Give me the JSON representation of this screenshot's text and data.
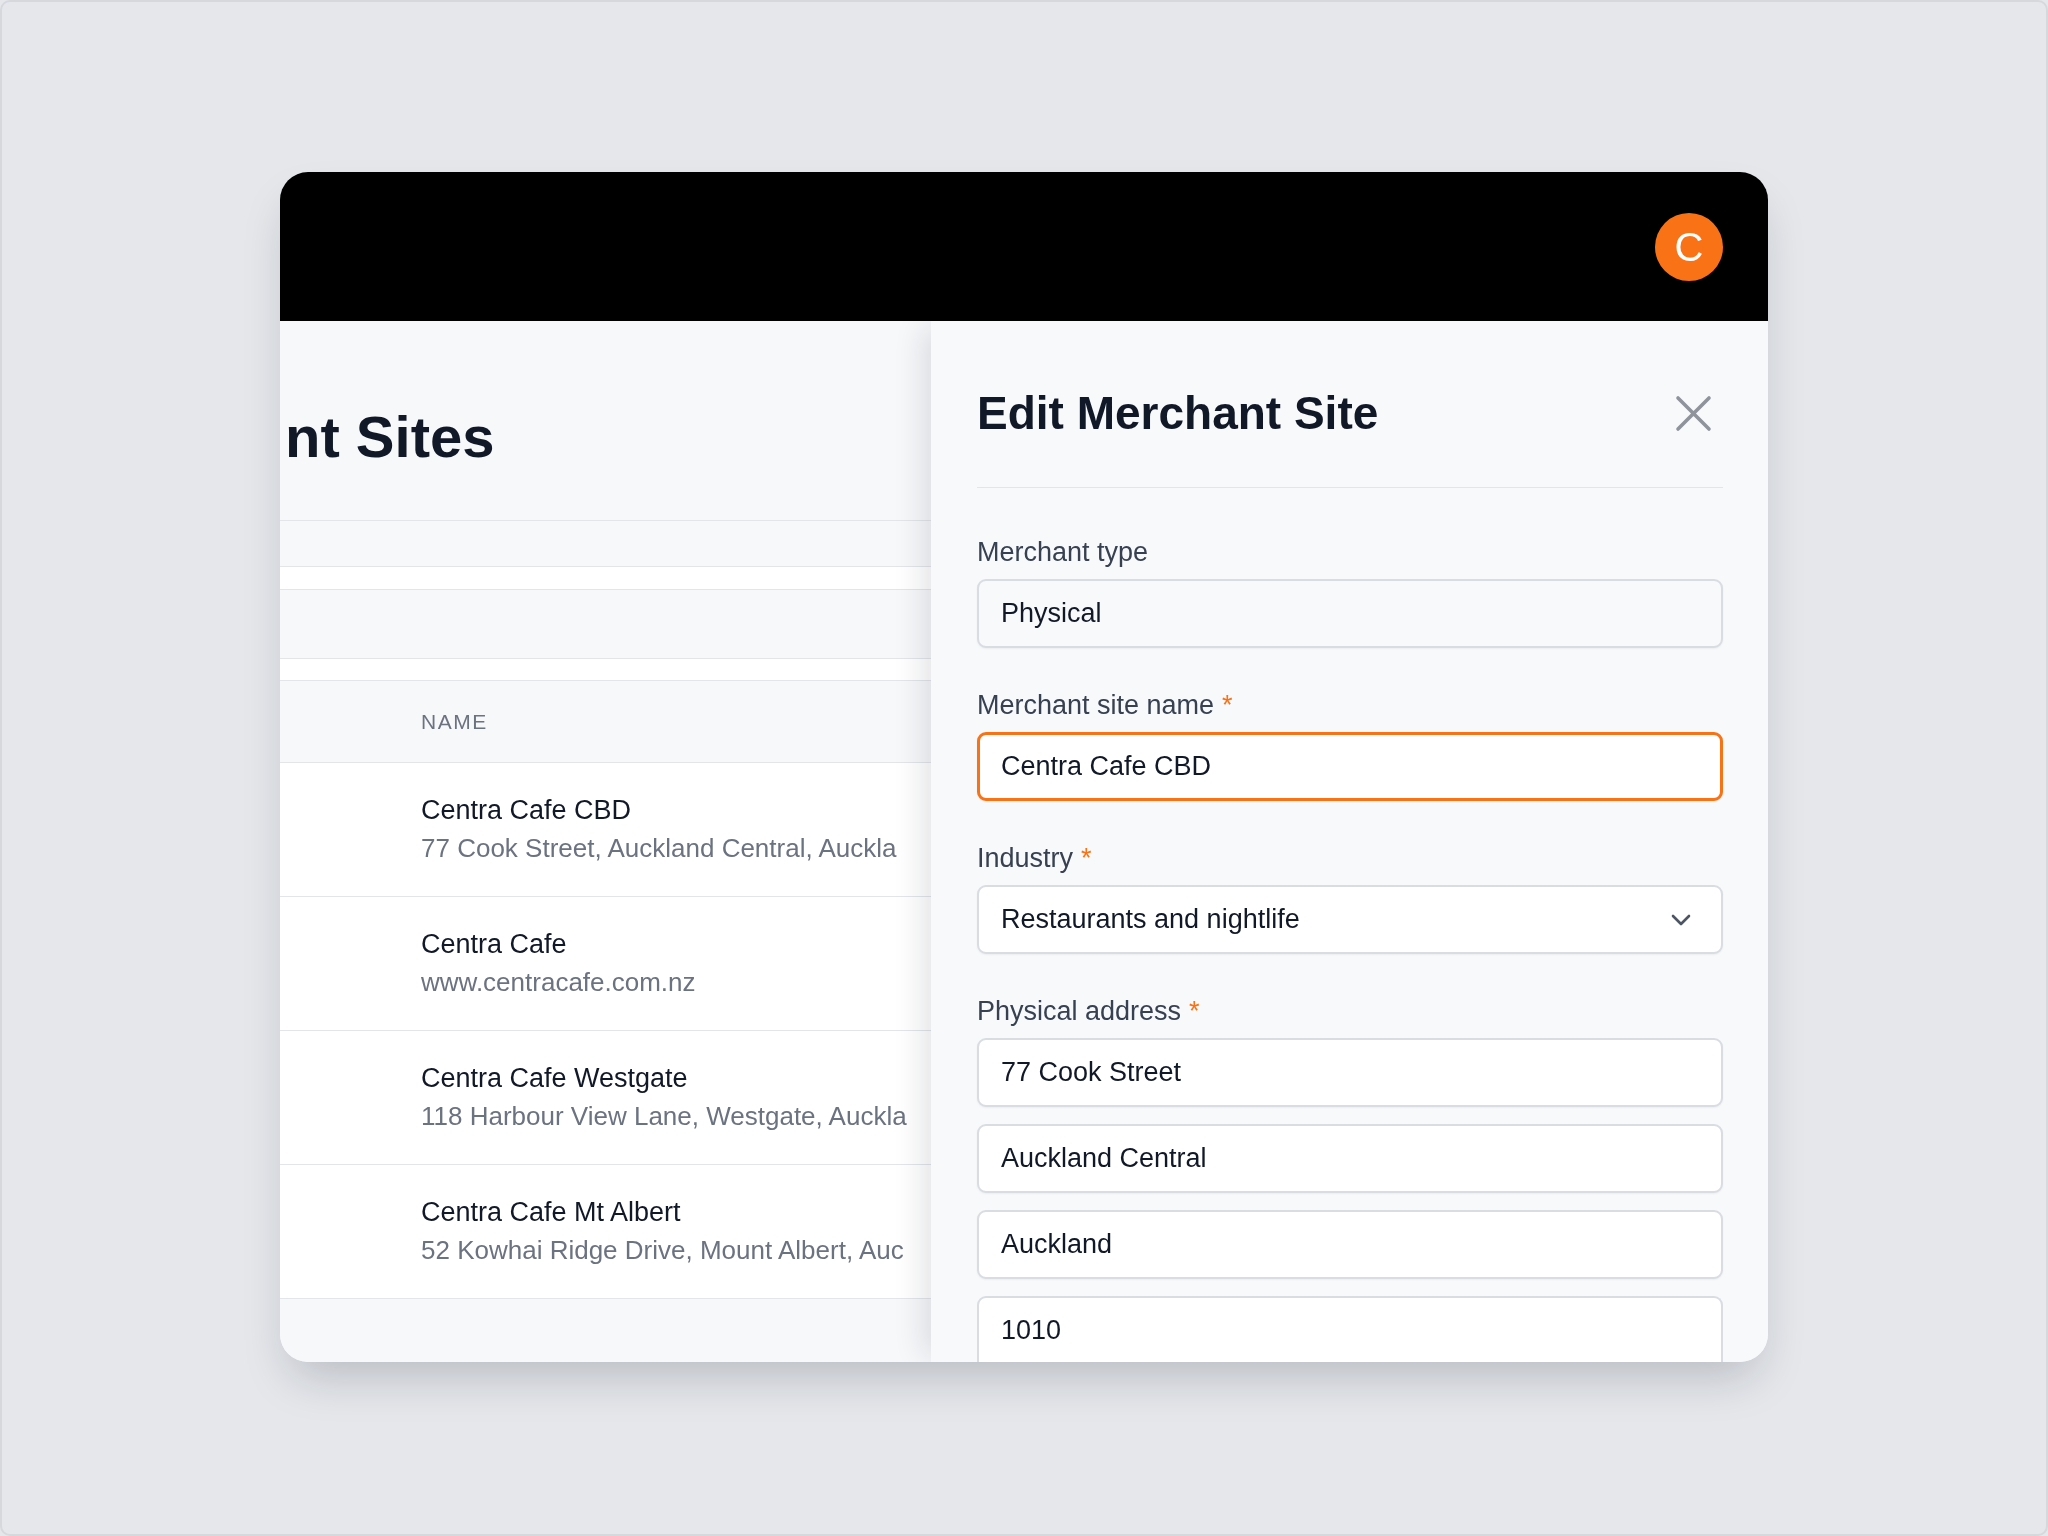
{
  "header": {
    "avatar": {
      "initial": "C"
    }
  },
  "sites_page": {
    "title": "nt Sites",
    "table": {
      "columns": [
        "NAME"
      ],
      "rows": [
        {
          "name": "Centra Cafe CBD",
          "detail": "77 Cook Street, Auckland Central, Auckla"
        },
        {
          "name": "Centra Cafe",
          "detail": "www.centracafe.com.nz"
        },
        {
          "name": "Centra Cafe Westgate",
          "detail": "118 Harbour View Lane, Westgate, Auckla"
        },
        {
          "name": "Centra Cafe Mt Albert",
          "detail": "52 Kowhai Ridge Drive, Mount Albert, Auc"
        }
      ]
    }
  },
  "edit_panel": {
    "title": "Edit Merchant Site",
    "fields": [
      {
        "label": "Merchant type",
        "inputs": [
          {
            "kind": "readonly",
            "value": "Physical",
            "focused": false
          }
        ]
      },
      {
        "label": "Merchant site name",
        "required_mark": "*",
        "inputs": [
          {
            "kind": "text",
            "value": "Centra Cafe CBD",
            "focused": true
          }
        ]
      },
      {
        "label": "Industry",
        "required_mark": "*",
        "inputs": [
          {
            "kind": "select",
            "value": "Restaurants and nightlife",
            "focused": false
          }
        ]
      },
      {
        "label": "Physical address",
        "required_mark": "*",
        "inputs": [
          {
            "kind": "text",
            "value": "77 Cook Street",
            "focused": false
          },
          {
            "kind": "text",
            "value": "Auckland Central",
            "focused": false
          },
          {
            "kind": "text",
            "value": "Auckland",
            "focused": false
          },
          {
            "kind": "text",
            "value": "1010",
            "focused": false
          }
        ]
      }
    ]
  }
}
